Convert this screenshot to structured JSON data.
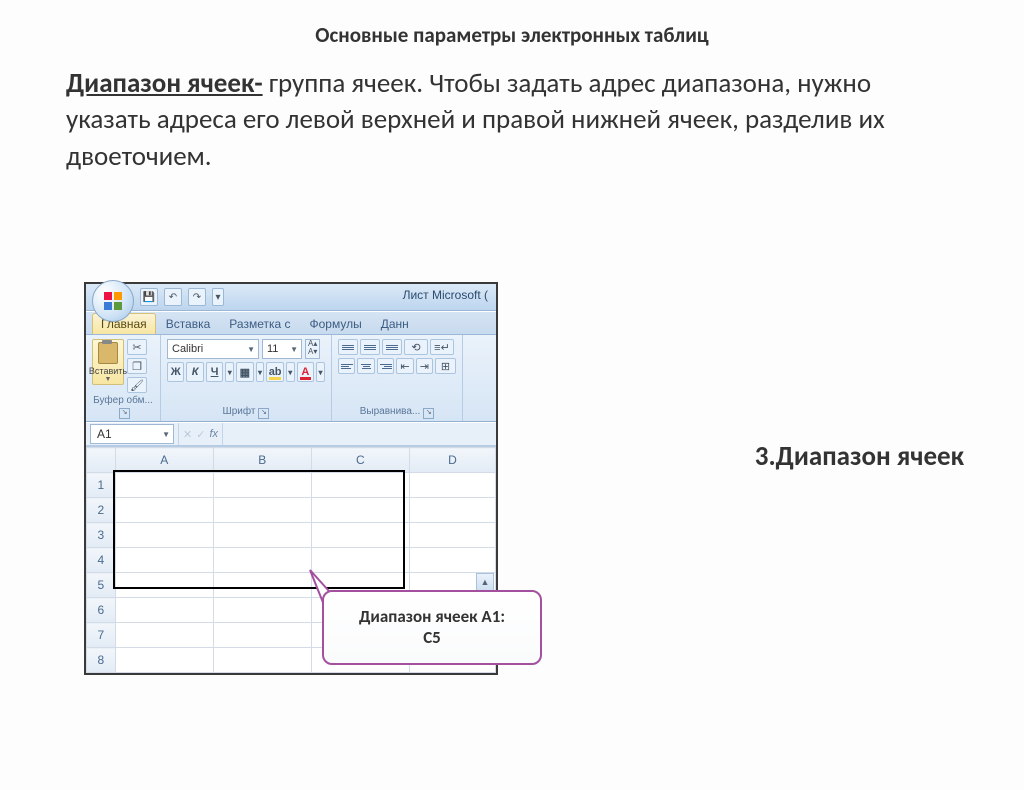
{
  "slide": {
    "title": "Основные параметры электронных таблиц",
    "term": "Диапазон ячеек-",
    "body_rest": " группа ячеек. Чтобы задать адрес диапазона, нужно указать адреса его левой верхней и правой нижней ячеек,  разделив их двоеточием.",
    "section_label": "3.Диапазон ячеек",
    "callout_line1": "Диапазон ячеек А1:",
    "callout_line2": "С5"
  },
  "excel": {
    "window_title": "Лист Microsoft (",
    "qat": {
      "save": "💾",
      "undo": "↶",
      "redo": "↷",
      "more": "▾"
    },
    "tabs": [
      "Главная",
      "Вставка",
      "Разметка с",
      "Формулы",
      "Данн"
    ],
    "active_tab": 0,
    "clipboard": {
      "paste": "Вставить",
      "group": "Буфер обм..."
    },
    "font": {
      "name": "Calibri",
      "size": "11",
      "bold": "Ж",
      "italic": "К",
      "underline": "Ч",
      "group": "Шрифт"
    },
    "align": {
      "group": "Выравнива..."
    },
    "name_box": "A1",
    "fx": "fx",
    "columns": [
      "A",
      "B",
      "C",
      "D"
    ],
    "rows": [
      "1",
      "2",
      "3",
      "4",
      "5",
      "6",
      "7",
      "8"
    ],
    "selection": "A1:C5"
  }
}
